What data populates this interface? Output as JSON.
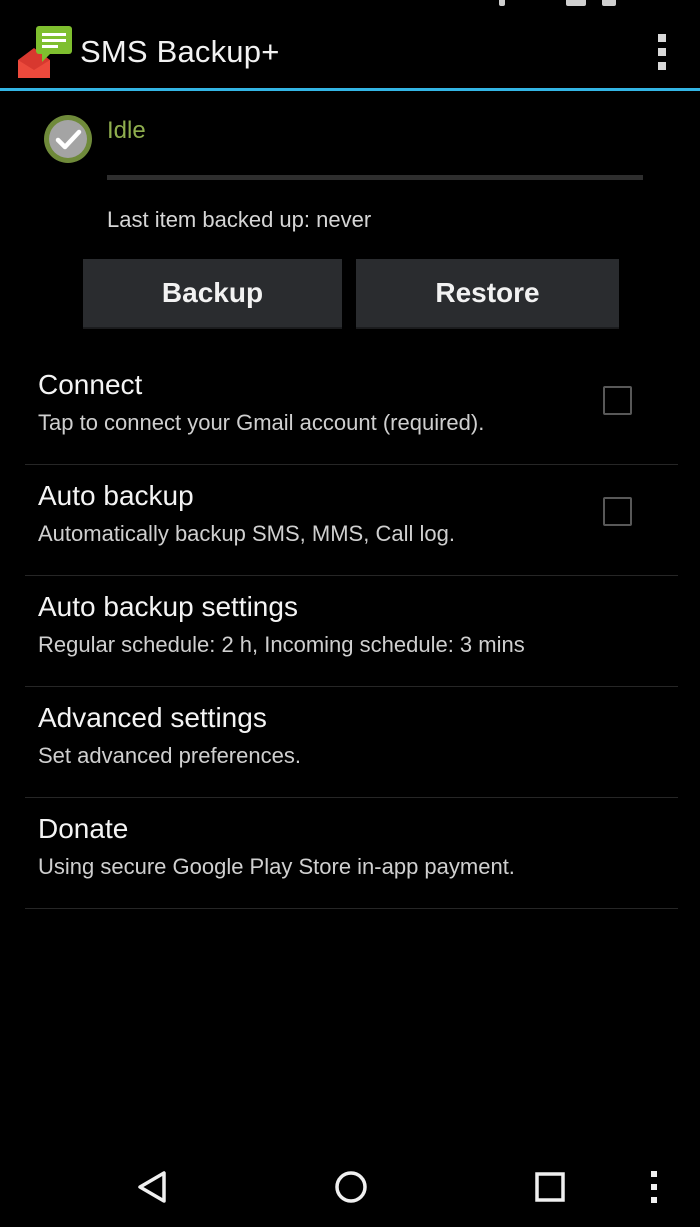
{
  "app": {
    "title": "SMS Backup+",
    "icon": "sms-backup-icon"
  },
  "status": {
    "state": "Idle",
    "icon": "check-circle-icon",
    "progress": 0,
    "last_backup": "Last item backed up: never",
    "color": "#8fae4e"
  },
  "buttons": {
    "backup": "Backup",
    "restore": "Restore"
  },
  "preferences": [
    {
      "title": "Connect",
      "summary": "Tap to connect your Gmail account (required).",
      "checkbox": true,
      "checked": false
    },
    {
      "title": "Auto backup",
      "summary": "Automatically backup SMS, MMS, Call log.",
      "checkbox": true,
      "checked": false
    },
    {
      "title": "Auto backup settings",
      "summary": "Regular schedule: 2 h, Incoming schedule: 3 mins",
      "checkbox": false
    },
    {
      "title": "Advanced settings",
      "summary": "Set advanced preferences.",
      "checkbox": false
    },
    {
      "title": "Donate",
      "summary": "Using secure Google Play Store in-app payment.",
      "checkbox": false
    }
  ],
  "nav": {
    "back": "back-icon",
    "home": "home-icon",
    "recents": "recents-icon",
    "menu": "menu-icon"
  },
  "colors": {
    "accent": "#33b5e5",
    "button_bg": "#2a2c2f"
  }
}
